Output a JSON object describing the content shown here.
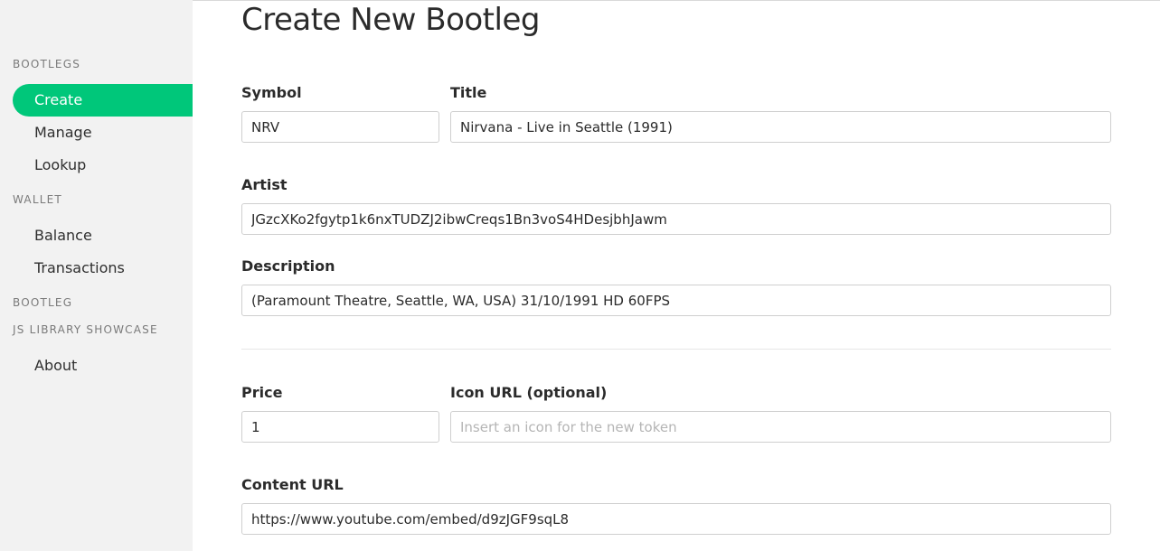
{
  "sidebar": {
    "sections": [
      {
        "header": "BOOTLEGS",
        "items": [
          "Create",
          "Manage",
          "Lookup"
        ]
      },
      {
        "header": "WALLET",
        "items": [
          "Balance",
          "Transactions"
        ]
      },
      {
        "header": "BOOTLEG",
        "items": []
      },
      {
        "header": "JS LIBRARY SHOWCASE",
        "items": [
          "About"
        ]
      }
    ],
    "active_item": "Create"
  },
  "main": {
    "title": "Create New Bootleg",
    "form": {
      "symbol": {
        "label": "Symbol",
        "value": "NRV"
      },
      "title": {
        "label": "Title",
        "value": "Nirvana - Live in Seattle (1991)"
      },
      "artist": {
        "label": "Artist",
        "value": "JGzcXKo2fgytp1k6nxTUDZJ2ibwCreqs1Bn3voS4HDesjbhJawm"
      },
      "description": {
        "label": "Description",
        "value": "(Paramount Theatre, Seattle, WA, USA) 31/10/1991 HD 60FPS"
      },
      "price": {
        "label": "Price",
        "value": "1"
      },
      "icon_url": {
        "label": "Icon URL (optional)",
        "value": "",
        "placeholder": "Insert an icon for the new token"
      },
      "content_url": {
        "label": "Content URL",
        "value": "https://www.youtube.com/embed/d9zJGF9sqL8"
      }
    }
  },
  "colors": {
    "accent": "#00c77a",
    "sidebar_bg": "#f2f2f2"
  }
}
